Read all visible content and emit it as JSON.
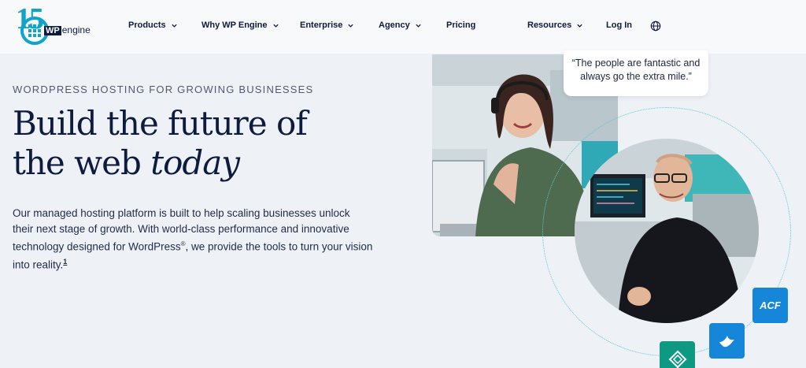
{
  "nav": {
    "logo": {
      "number": "15",
      "wp": "WP",
      "engine": "engine"
    },
    "items": [
      {
        "label": "Products",
        "has_dropdown": true
      },
      {
        "label": "Why WP Engine",
        "has_dropdown": true
      },
      {
        "label": "Enterprise",
        "has_dropdown": true
      },
      {
        "label": "Agency",
        "has_dropdown": true
      },
      {
        "label": "Pricing",
        "has_dropdown": false
      },
      {
        "label": "Resources",
        "has_dropdown": true
      },
      {
        "label": "Log In",
        "has_dropdown": false
      }
    ],
    "globe_icon": "globe-icon"
  },
  "hero": {
    "eyebrow": "WORDPRESS HOSTING FOR GROWING BUSINESSES",
    "headline_line1": "Build the future of",
    "headline_line2_plain": "the web ",
    "headline_line2_em": "today",
    "body_part1": "Our managed hosting platform is built to help scaling businesses unlock their next stage of growth. With world-class performance and innovative technology designed for WordPress",
    "body_reg": "®",
    "body_part2": ", we provide the tools to turn your vision into reality.",
    "footnote": "1"
  },
  "quote": {
    "line1": "“The people are fantastic and",
    "line2": "always go the extra mile.”"
  },
  "badges": {
    "acf": "ACF"
  },
  "colors": {
    "brand": "#0ea5c9",
    "navy": "#0d1b3e",
    "background": "#eef2f7",
    "badge_blue": "#1686d9",
    "badge_green": "#0e9a82"
  }
}
